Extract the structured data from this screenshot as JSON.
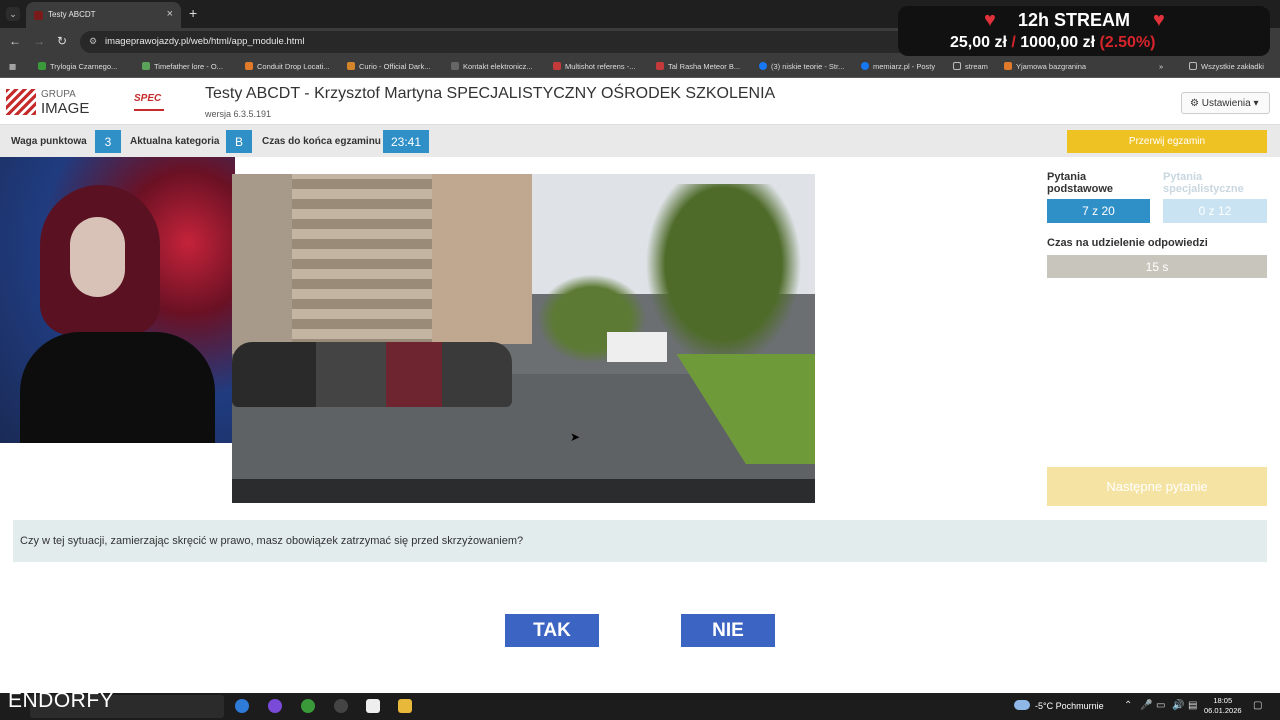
{
  "browser": {
    "tab_title": "Testy ABCDT",
    "url": "imageprawojazdy.pl/web/html/app_module.html",
    "bookmarks": [
      {
        "label": "Trylogia Czarnego...",
        "color": "#3a9a3a"
      },
      {
        "label": "Timefather lore - O...",
        "color": "#5aa25a"
      },
      {
        "label": "Conduit Drop Locati...",
        "color": "#e07a2a"
      },
      {
        "label": "Curio - Official Dark...",
        "color": "#d4852a"
      },
      {
        "label": "Kontakt elektronicz...",
        "color": "#666666"
      },
      {
        "label": "Multishot referens -...",
        "color": "#c43a3a"
      },
      {
        "label": "Tal Rasha Meteor B...",
        "color": "#c43a3a"
      },
      {
        "label": "(3) niskie teorie - Str...",
        "color": "#1877f2"
      },
      {
        "label": "memiarz.pl - Posty",
        "color": "#1877f2"
      },
      {
        "label": "stream",
        "color": "#888888"
      },
      {
        "label": "Yjamowa bazgranina",
        "color": "#e07a2a"
      }
    ],
    "all_bookmarks": "Wszystkie zakładki"
  },
  "stream_overlay": {
    "title": "12h STREAM",
    "amount": "25,00 zł",
    "goal": "1000,00 zł",
    "percent": "(2.50%)"
  },
  "app": {
    "logo_top": "GRUPA",
    "logo_bottom": "IMAGE",
    "logo_spec": "SPEC",
    "title": "Testy ABCDT - Krzysztof Martyna SPECJALISTYCZNY OŚRODEK SZKOLENIA",
    "version": "wersja 6.3.5.191",
    "settings": "Ustawienia"
  },
  "infobar": {
    "weight_label": "Waga punktowa",
    "weight_value": "3",
    "category_label": "Aktualna kategoria",
    "category_value": "B",
    "time_label": "Czas do końca egzaminu",
    "time_value": "23:41",
    "stop_button": "Przerwij egzamin"
  },
  "panel": {
    "basic_label": "Pytania podstawowe",
    "basic_count": "7 z 20",
    "special_label": "Pytania specjalistyczne",
    "special_count": "0 z 12",
    "answer_time_label": "Czas na udzielenie odpowiedzi",
    "answer_time": "15 s",
    "next_button": "Następne pytanie"
  },
  "question": "Czy w tej sytuacji, zamierzając skręcić w prawo, masz obowiązek zatrzymać się przed skrzyżowaniem?",
  "answers": {
    "yes": "TAK",
    "no": "NIE"
  },
  "taskbar": {
    "brand": "ENDORFY",
    "weather": "-5°C  Pochmurnie",
    "time": "18:05",
    "date": "06.01.2026"
  },
  "colors": {
    "accent_blue": "#2f8fc7",
    "answer_blue": "#3c64c2",
    "stop_yellow": "#efc224",
    "next_yellow": "#f5e3a4"
  }
}
